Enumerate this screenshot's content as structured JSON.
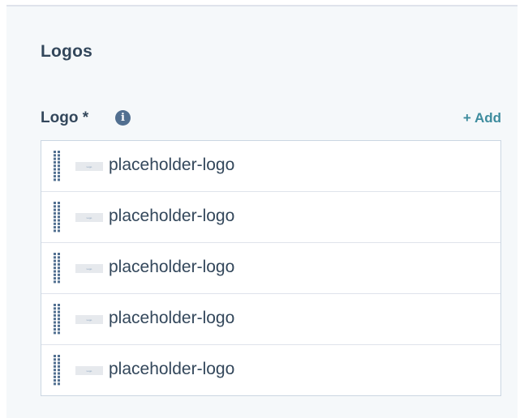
{
  "section": {
    "title": "Logos"
  },
  "field": {
    "label": "Logo *",
    "info_icon": "info-circle-icon",
    "add_label": "+ Add"
  },
  "logos": [
    {
      "name": "placeholder-logo",
      "thumb_text": "Logo"
    },
    {
      "name": "placeholder-logo",
      "thumb_text": "Logo"
    },
    {
      "name": "placeholder-logo",
      "thumb_text": "Logo"
    },
    {
      "name": "placeholder-logo",
      "thumb_text": "Logo"
    },
    {
      "name": "placeholder-logo",
      "thumb_text": "Logo"
    }
  ],
  "colors": {
    "panel_bg": "#f5f8fa",
    "text": "#33475b",
    "accent": "#3e8c9e",
    "border": "#cbd6e2"
  }
}
